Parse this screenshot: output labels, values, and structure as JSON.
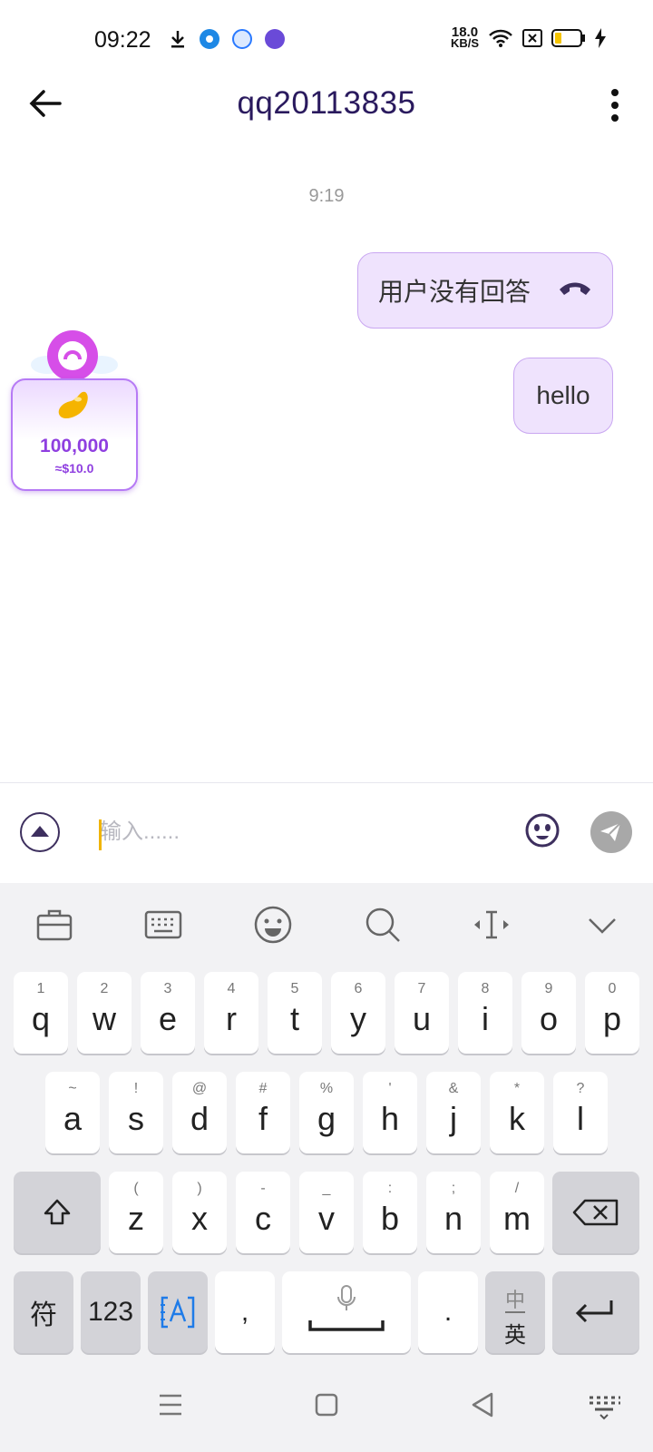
{
  "status_bar": {
    "time": "09:22",
    "net_speed_value": "18.0",
    "net_speed_unit": "KB/S",
    "icons": [
      "download-icon",
      "app-notification-icon",
      "browser-icon",
      "app-icon",
      "wifi-icon",
      "sim-off-icon",
      "battery-icon",
      "charging-icon"
    ]
  },
  "header": {
    "title": "qq20113835"
  },
  "chat": {
    "timestamp": "9:19",
    "messages": [
      {
        "type": "call",
        "text": "用户没有回答",
        "icon": "phone-hangup-icon"
      },
      {
        "type": "text",
        "text": "hello"
      }
    ]
  },
  "gift": {
    "amount": "100,000",
    "value": "≈$10.0"
  },
  "input": {
    "placeholder": "输入......",
    "value": ""
  },
  "keyboard": {
    "toolbar": [
      "briefcase-icon",
      "keyboard-layout-icon",
      "emoji-icon",
      "search-icon",
      "cursor-move-icon",
      "collapse-icon"
    ],
    "row1": [
      {
        "main": "q",
        "hint": "1"
      },
      {
        "main": "w",
        "hint": "2"
      },
      {
        "main": "e",
        "hint": "3"
      },
      {
        "main": "r",
        "hint": "4"
      },
      {
        "main": "t",
        "hint": "5"
      },
      {
        "main": "y",
        "hint": "6"
      },
      {
        "main": "u",
        "hint": "7"
      },
      {
        "main": "i",
        "hint": "8"
      },
      {
        "main": "o",
        "hint": "9"
      },
      {
        "main": "p",
        "hint": "0"
      }
    ],
    "row2": [
      {
        "main": "a",
        "hint": "~"
      },
      {
        "main": "s",
        "hint": "!"
      },
      {
        "main": "d",
        "hint": "@"
      },
      {
        "main": "f",
        "hint": "#"
      },
      {
        "main": "g",
        "hint": "%"
      },
      {
        "main": "h",
        "hint": "'"
      },
      {
        "main": "j",
        "hint": "&"
      },
      {
        "main": "k",
        "hint": "*"
      },
      {
        "main": "l",
        "hint": "?"
      }
    ],
    "row3": [
      {
        "main": "z",
        "hint": "("
      },
      {
        "main": "x",
        "hint": ")"
      },
      {
        "main": "c",
        "hint": "-"
      },
      {
        "main": "v",
        "hint": "_"
      },
      {
        "main": "b",
        "hint": ":"
      },
      {
        "main": "n",
        "hint": ";"
      },
      {
        "main": "m",
        "hint": "/"
      }
    ],
    "symbols_key": "符",
    "numbers_key": "123",
    "comma_key": ",",
    "period_key": ".",
    "lang_key_top": "中",
    "lang_key_bottom": "英"
  },
  "nav_bar": {
    "buttons": [
      "menu-icon",
      "home-icon",
      "back-icon",
      "keyboard-hide-icon"
    ]
  }
}
